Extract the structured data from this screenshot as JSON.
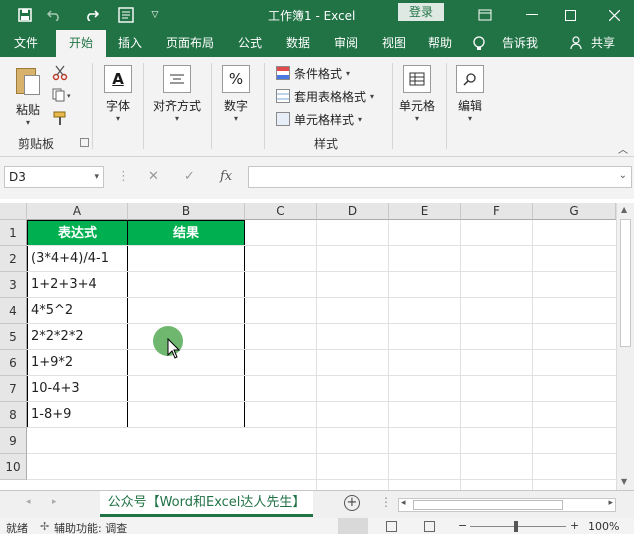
{
  "titlebar": {
    "title": "工作簿1  -  Excel",
    "login_label": "登录",
    "icons": [
      "save-icon",
      "undo-icon",
      "redo-icon",
      "print-preview-icon",
      "customize-qat-icon",
      "ribbon-display-icon",
      "minimize-icon",
      "maximize-icon",
      "close-icon"
    ]
  },
  "ribbon_tabs": [
    "文件",
    "开始",
    "插入",
    "页面布局",
    "公式",
    "数据",
    "审阅",
    "视图",
    "帮助",
    "告诉我",
    "共享"
  ],
  "ribbon": {
    "paste_label": "粘贴",
    "clipboard_label": "剪贴板",
    "font_label": "字体",
    "align_label": "对齐方式",
    "number_label": "数字",
    "cond_format_label": "条件格式",
    "table_format_label": "套用表格格式",
    "cell_style_label": "单元格样式",
    "styles_label": "样式",
    "cells_label": "单元格",
    "edit_label": "编辑",
    "font_icon_glyph": "A",
    "number_icon_glyph": "%"
  },
  "formula_bar": {
    "name_box": "D3",
    "fx": "fx",
    "formula": ""
  },
  "columns": [
    "A",
    "B",
    "C",
    "D",
    "E",
    "F",
    "G"
  ],
  "rows": [
    "1",
    "2",
    "3",
    "4",
    "5",
    "6",
    "7",
    "8",
    "9",
    "10"
  ],
  "table": {
    "header": [
      "表达式",
      "结果"
    ],
    "expressions": [
      "(3*4+4)/4-1",
      "1+2+3+4",
      "4*5^2",
      "2*2*2*2",
      "1+9*2",
      "10-4+3",
      "1-8+9"
    ]
  },
  "sheet_tab": "公众号【Word和Excel达人先生】",
  "status": {
    "ready": "就绪",
    "accessibility": "辅助功能: 调查",
    "zoom": "100%"
  },
  "colors": {
    "accent": "#217346",
    "header_fill": "#00b050"
  }
}
